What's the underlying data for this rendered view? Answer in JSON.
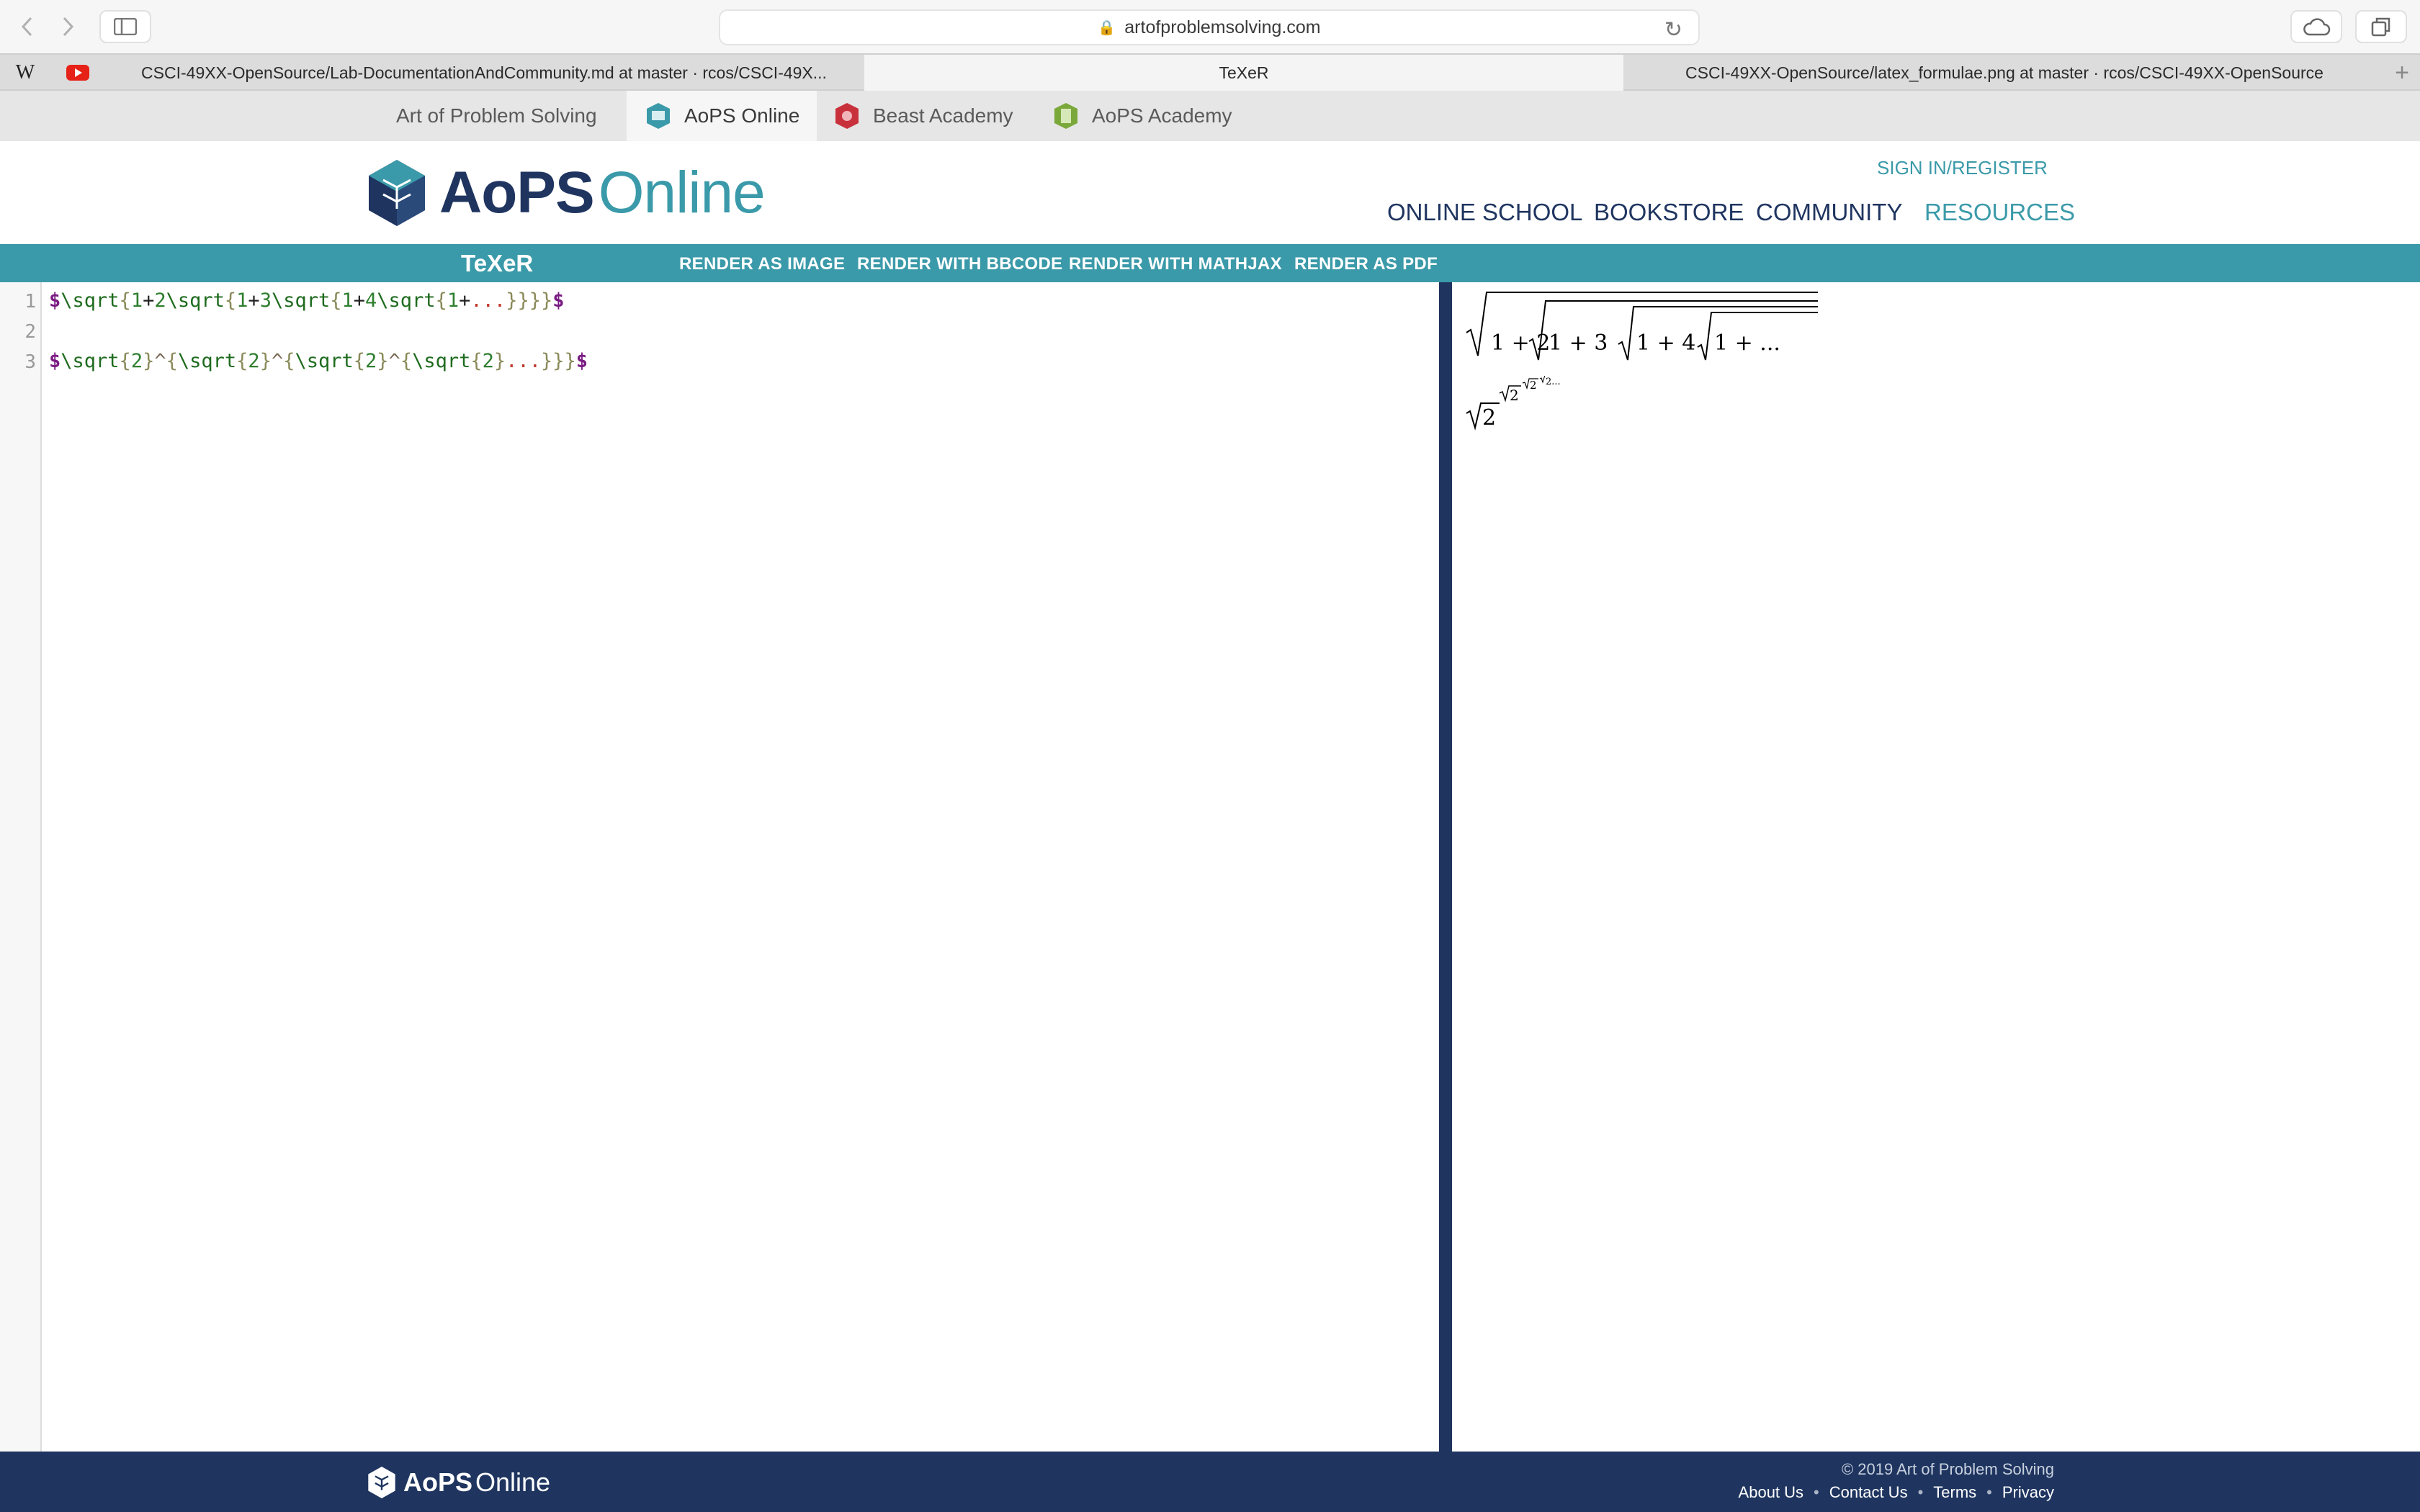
{
  "browser": {
    "url": "artofproblemsolving.com",
    "tabs": [
      {
        "title": "CSCI-49XX-OpenSource/Lab-DocumentationAndCommunity.md at master · rcos/CSCI-49X..."
      },
      {
        "title": "TeXeR"
      },
      {
        "title": "CSCI-49XX-OpenSource/latex_formulae.png at master · rcos/CSCI-49XX-OpenSource"
      }
    ],
    "pinned_icons": [
      "wikipedia-icon",
      "youtube-icon"
    ]
  },
  "sitenav": {
    "items": [
      {
        "label": "Art of Problem Solving"
      },
      {
        "label": "AoPS Online"
      },
      {
        "label": "Beast Academy"
      },
      {
        "label": "AoPS Academy"
      }
    ]
  },
  "header": {
    "logo_bold": "AoPS",
    "logo_light": "Online",
    "signin": "SIGN IN/REGISTER",
    "nav": [
      "ONLINE SCHOOL",
      "BOOKSTORE",
      "COMMUNITY",
      "RESOURCES"
    ]
  },
  "texer": {
    "title": "TeXeR",
    "buttons": [
      "RENDER AS IMAGE",
      "RENDER WITH BBCODE",
      "RENDER WITH MATHJAX",
      "RENDER AS PDF"
    ]
  },
  "editor": {
    "line_numbers": [
      "1",
      "2",
      "3"
    ],
    "lines": [
      "$\\sqrt{1+2\\sqrt{1+3\\sqrt{1+4\\sqrt{1+...}}}}$",
      "",
      "$\\sqrt{2}^{\\sqrt{2}^{\\sqrt{2}^{\\sqrt{2}...}}}$"
    ]
  },
  "preview": {
    "formula1": [
      "1 + 2",
      "1 + 3",
      "1 + 4",
      "1 + ..."
    ],
    "formula2": [
      "2",
      "2",
      "2",
      "2..."
    ]
  },
  "footer": {
    "logo_bold": "AoPS",
    "logo_light": "Online",
    "copyright": "© 2019 Art of Problem Solving",
    "links": [
      "About Us",
      "Contact Us",
      "Terms",
      "Privacy"
    ]
  },
  "colors": {
    "teal": "#3b9aa9",
    "navy": "#1f3560"
  }
}
